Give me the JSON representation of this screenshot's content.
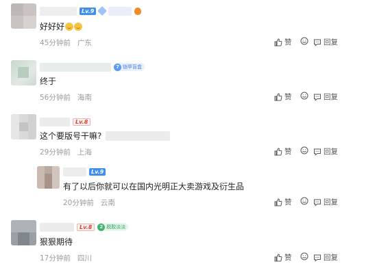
{
  "comments": [
    {
      "level": "Lv.9",
      "text": "好好好",
      "time": "45分钟前",
      "location": "广东",
      "like_label": "赞",
      "reply_label": "回复"
    },
    {
      "badge": "铠甲盲盒",
      "text": "终于",
      "time": "56分钟前",
      "location": "海南",
      "like_label": "赞",
      "reply_label": "回复"
    },
    {
      "level": "Lv.8",
      "text": "这个要版号干嘛?",
      "time": "29分钟前",
      "location": "上海",
      "like_label": "赞",
      "reply_label": "回复"
    },
    {
      "level": "Lv.9",
      "text": "有了以后你就可以在国内光明正大卖游戏及衍生品",
      "time": "20分钟前",
      "location": "云南",
      "like_label": "赞",
      "reply_label": "回复"
    },
    {
      "level": "Lv.8",
      "badge": "脱胶淡淡",
      "text": "狠狠期待",
      "time": "17分钟前",
      "location": "四川",
      "like_label": "赞",
      "reply_label": "回复"
    }
  ],
  "icons": {
    "like": "thumbs-up-icon",
    "dislike": "smile-icon",
    "reply": "reply-bubble-icon"
  },
  "colors": {
    "level_blue": "#3f8ef0",
    "level_red": "#e8402e",
    "meta_gray": "#9a9a9a"
  }
}
